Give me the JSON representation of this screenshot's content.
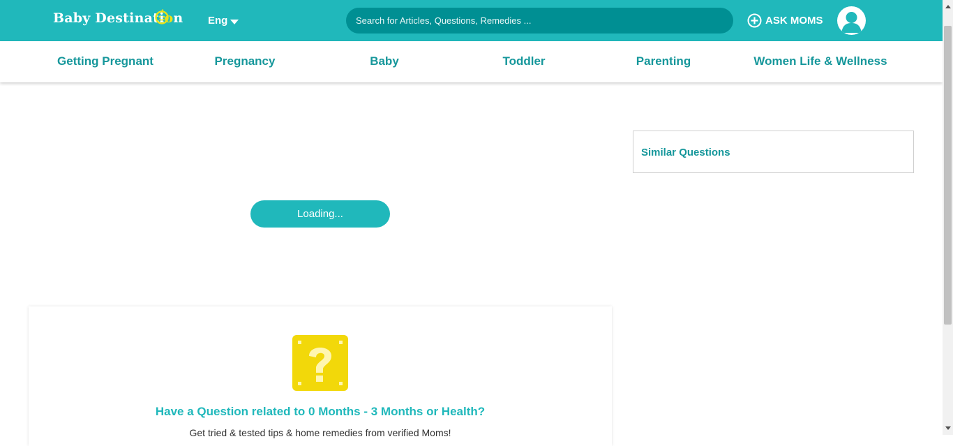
{
  "header": {
    "logo_text_part1": "Baby Destinati",
    "logo_text_part2": "n",
    "language": "Eng",
    "search_placeholder": "Search for Articles, Questions, Remedies ...",
    "ask_moms_label": "ASK MOMS"
  },
  "nav": {
    "items": [
      {
        "label": "Getting Pregnant"
      },
      {
        "label": "Pregnancy"
      },
      {
        "label": "Baby"
      },
      {
        "label": "Toddler"
      },
      {
        "label": "Parenting"
      },
      {
        "label": "Women Life & Wellness"
      }
    ]
  },
  "main": {
    "loading_label": "Loading..."
  },
  "sidebar": {
    "similar_title": "Similar Questions"
  },
  "ask_card": {
    "title": "Have a Question related to 0 Months - 3 Months or Health?",
    "subtitle": "Get tried & tested tips & home remedies from verified Moms!"
  },
  "colors": {
    "brand": "#20b8bb",
    "brand_dark": "#16979b",
    "search_bg": "#008f93",
    "question_block": "#f2d80a"
  }
}
